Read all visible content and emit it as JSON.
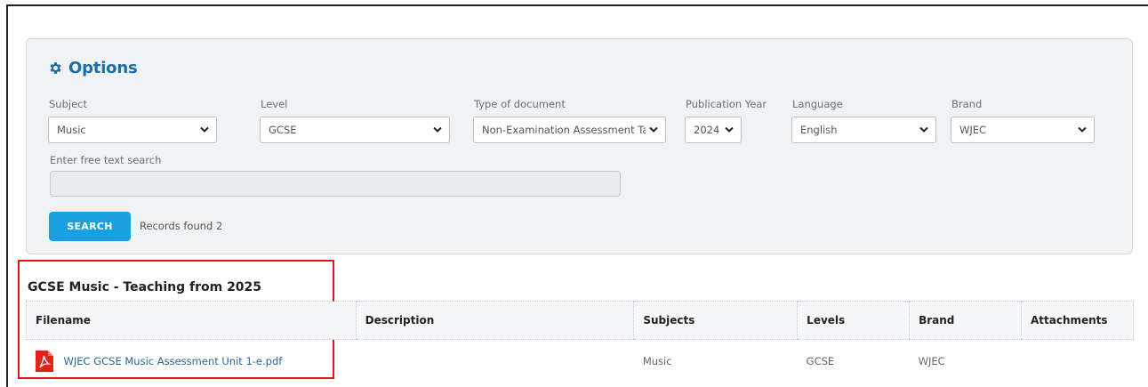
{
  "options": {
    "title": "Options",
    "fields": [
      {
        "label": "Subject",
        "value": "Music"
      },
      {
        "label": "Level",
        "value": "GCSE"
      },
      {
        "label": "Type of document",
        "value": "Non-Examination Assessment Ta"
      },
      {
        "label": "Publication Year",
        "value": "2024"
      },
      {
        "label": "Language",
        "value": "English"
      },
      {
        "label": "Brand",
        "value": "WJEC"
      }
    ],
    "search_label": "Enter free text search",
    "search_value": "",
    "search_button": "SEARCH",
    "records_found": "Records found 2"
  },
  "results": {
    "heading": "GCSE Music - Teaching from 2025",
    "columns": [
      "Filename",
      "Description",
      "Subjects",
      "Levels",
      "Brand",
      "Attachments"
    ],
    "rows": [
      {
        "filename": "WJEC GCSE Music Assessment Unit 1-e.pdf",
        "description": "",
        "subjects": "Music",
        "levels": "GCSE",
        "brand": "WJEC",
        "attachments": ""
      }
    ]
  },
  "colors": {
    "accent": "#1b6fa8",
    "button": "#1a9fe0",
    "highlight": "#e8141d",
    "pdf_icon": "#e2231a"
  },
  "icons": [
    "gear-icon",
    "chevron-down-icon",
    "pdf-file-icon"
  ]
}
